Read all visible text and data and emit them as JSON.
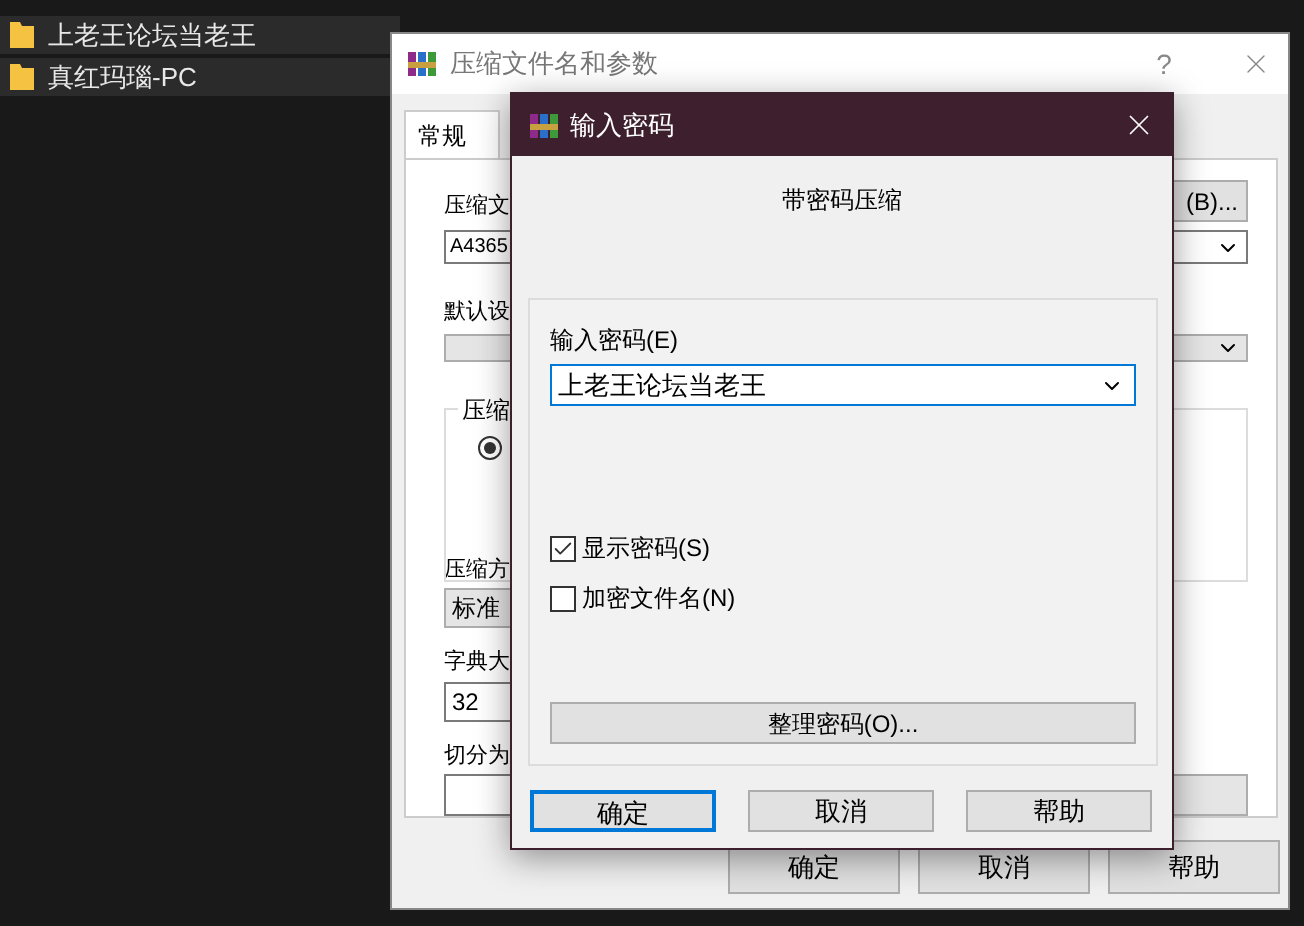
{
  "file_list": [
    {
      "name": "上老王论坛当老王"
    },
    {
      "name": "真红玛瑙-PC"
    }
  ],
  "archive_dialog": {
    "title": "压缩文件名和参数",
    "help_button": "?",
    "tabs": [
      {
        "label": "常规",
        "selected": true
      }
    ],
    "archive_name_label": "压缩文",
    "archive_name_value": "A4365",
    "browse_button": "(B)...",
    "profile_label": "默认设",
    "method_group_label": "压缩",
    "format_radio": {
      "selected": true
    },
    "method_label": "压缩方",
    "method_value": "标准",
    "dictionary_label": "字典大",
    "dictionary_value": "32",
    "split_label": "切分为",
    "buttons": [
      "确定",
      "取消",
      "帮助"
    ]
  },
  "password_dialog": {
    "title": "输入密码",
    "heading": "带密码压缩",
    "password_label": "输入密码(E)",
    "password_value": "上老王论坛当老王",
    "options": [
      {
        "label": "显示密码(S)",
        "checked": true
      },
      {
        "label": "加密文件名(N)",
        "checked": false
      }
    ],
    "organize_button": "整理密码(O)...",
    "buttons": [
      {
        "label": "确定",
        "focused": true
      },
      {
        "label": "取消",
        "focused": false
      },
      {
        "label": "帮助",
        "focused": false
      }
    ]
  }
}
